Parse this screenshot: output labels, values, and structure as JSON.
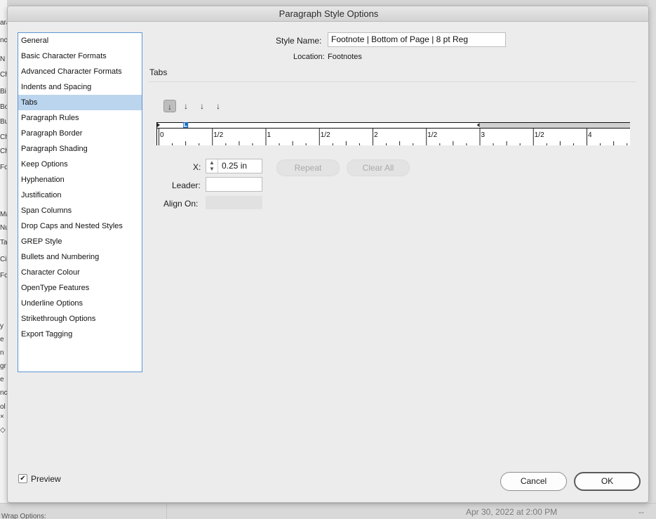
{
  "background": {
    "left_fragments": [
      "ara",
      "nc",
      "N",
      "Ch",
      "Bi",
      "Bo",
      "Bu",
      "Ch",
      "Ch",
      "Fo",
      "Ma",
      "Nu",
      "Ta",
      "Ci",
      "Fo",
      "y",
      "e",
      "n",
      "gr",
      "e",
      "nc",
      "ol",
      "×",
      "◇"
    ],
    "bottom_date": "Apr 30, 2022 at 2:00 PM",
    "bottom_dash": "--",
    "bottom_left": "Wrap Options:"
  },
  "dialog": {
    "title": "Paragraph Style Options",
    "categories": [
      "General",
      "Basic Character Formats",
      "Advanced Character Formats",
      "Indents and Spacing",
      "Tabs",
      "Paragraph Rules",
      "Paragraph Border",
      "Paragraph Shading",
      "Keep Options",
      "Hyphenation",
      "Justification",
      "Span Columns",
      "Drop Caps and Nested Styles",
      "GREP Style",
      "Bullets and Numbering",
      "Character Colour",
      "OpenType Features",
      "Underline Options",
      "Strikethrough Options",
      "Export Tagging"
    ],
    "selected_category": "Tabs",
    "style_name_label": "Style Name:",
    "style_name_value": "Footnote | Bottom of Page | 8 pt Reg",
    "location_label": "Location:",
    "location_value": "Footnotes",
    "section_title": "Tabs",
    "tab_alignment_buttons": [
      {
        "icon": "left-justified-tab-icon",
        "glyph": "↓",
        "active": true
      },
      {
        "icon": "center-justified-tab-icon",
        "glyph": "↓",
        "active": false
      },
      {
        "icon": "right-justified-tab-icon",
        "glyph": "↓",
        "active": false
      },
      {
        "icon": "align-to-decimal-tab-icon",
        "glyph": "↓",
        "active": false
      }
    ],
    "ruler": {
      "labels": [
        "0",
        "1/2",
        "1",
        "1/2",
        "2",
        "1/2",
        "3",
        "1/2",
        "4"
      ],
      "tab_stop_in": 0.25,
      "right_indent_in": 3
    },
    "x_label": "X:",
    "x_value": "0.25 in",
    "leader_label": "Leader:",
    "leader_value": "",
    "align_on_label": "Align On:",
    "align_on_value": "",
    "repeat_label": "Repeat",
    "clear_all_label": "Clear All",
    "preview_label": "Preview",
    "preview_checked": true,
    "cancel_label": "Cancel",
    "ok_label": "OK"
  }
}
